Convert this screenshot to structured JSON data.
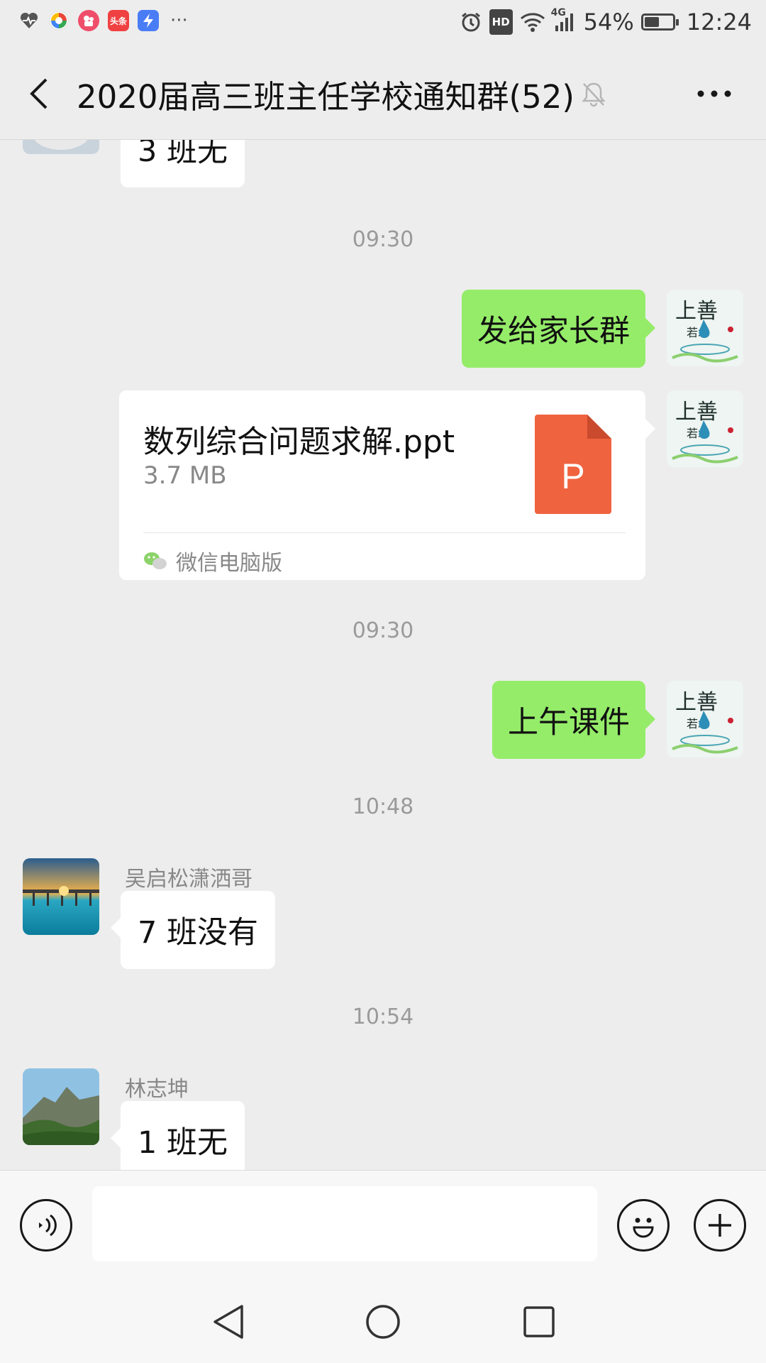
{
  "status_bar": {
    "left_icons": [
      "health-app-icon",
      "photos-app-icon",
      "video-app-icon",
      "toutiao-app-icon",
      "flash-app-icon",
      "more-notifications-icon"
    ],
    "toutiao_label": "头条",
    "more": "···",
    "hd": "HD",
    "network": "4G",
    "battery": "54%",
    "battery_level": 0.54,
    "time": "12:24"
  },
  "header": {
    "title": "2020届高三班主任学校通知群(52)",
    "muted": true
  },
  "messages": {
    "m1": {
      "text": "3 班无"
    },
    "t1": "09:30",
    "m2": {
      "text": "发给家长群"
    },
    "file": {
      "name": "数列综合问题求解.ppt",
      "size": "3.7 MB",
      "type_letter": "P",
      "source": "微信电脑版"
    },
    "t2": "09:30",
    "m3": {
      "text": "上午课件"
    },
    "t3": "10:48",
    "m4": {
      "sender": "吴启松潇洒哥",
      "text": "7 班没有"
    },
    "t4": "10:54",
    "m5": {
      "sender": "林志坤",
      "text": "1 班无"
    }
  },
  "input_bar": {
    "placeholder": "",
    "icons": [
      "voice-icon",
      "emoji-icon",
      "plus-icon"
    ]
  },
  "colors": {
    "background": "#ededed",
    "self_bubble": "#95ec69",
    "other_bubble": "#ffffff",
    "ppt_icon": "#f0633f"
  }
}
